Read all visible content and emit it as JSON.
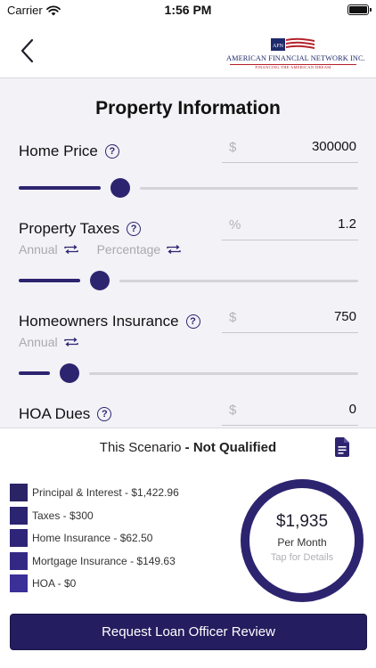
{
  "status_bar": {
    "carrier": "Carrier",
    "time": "1:56 PM"
  },
  "nav": {
    "back_icon": "chevron-left-icon",
    "logo": {
      "badge": "AFN",
      "name": "AMERICAN FINANCIAL NETWORK INC.",
      "tagline": "FINANCING THE AMERICAN DREAM"
    }
  },
  "page": {
    "title": "Property Information"
  },
  "fields": {
    "home_price": {
      "label": "Home Price",
      "unit": "$",
      "value": "300000",
      "slider_fraction": 0.3
    },
    "property_taxes": {
      "label": "Property Taxes",
      "unit": "%",
      "value": "1.2",
      "toggle_period": "Annual",
      "toggle_mode": "Percentage",
      "slider_fraction": 0.24
    },
    "homeowners_insurance": {
      "label": "Homeowners Insurance",
      "unit": "$",
      "value": "750",
      "toggle_period": "Annual",
      "slider_fraction": 0.15
    },
    "hoa_dues": {
      "label": "HOA Dues",
      "unit": "$",
      "value": "0"
    }
  },
  "summary": {
    "scenario_prefix": "This Scenario",
    "scenario_status": " - Not Qualified",
    "legend": [
      {
        "label": "Principal & Interest - $1,422.96",
        "color": "#2a2366"
      },
      {
        "label": "Taxes - $300",
        "color": "#2b2470"
      },
      {
        "label": "Home Insurance - $62.50",
        "color": "#2e2579"
      },
      {
        "label": "Mortgage Insurance - $149.63",
        "color": "#332985"
      },
      {
        "label": "HOA - $0",
        "color": "#3b2f98"
      }
    ],
    "donut": {
      "amount": "$1,935",
      "label": "Per Month",
      "hint": "Tap for Details"
    },
    "cta_label": "Request Loan Officer Review"
  },
  "colors": {
    "accent": "#2d2470",
    "button": "#241d5f"
  }
}
